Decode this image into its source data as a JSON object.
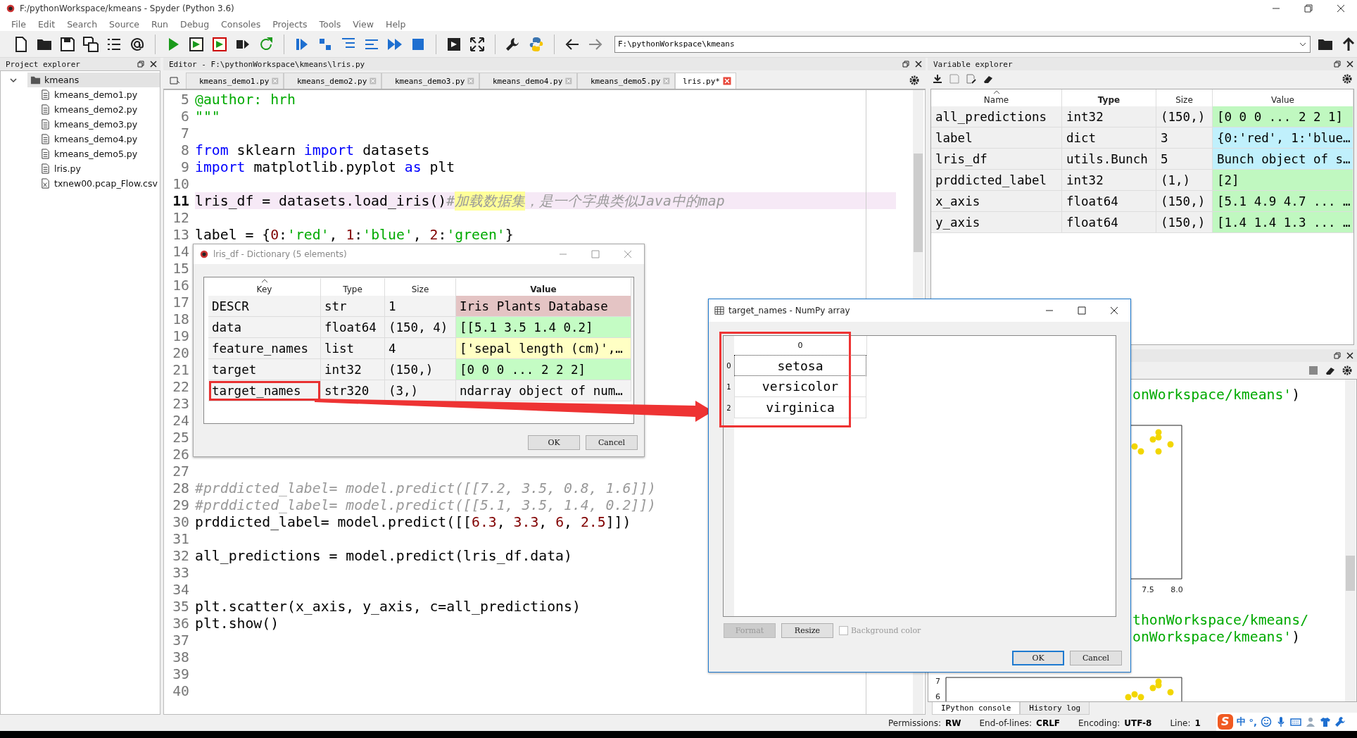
{
  "window": {
    "title": "F:/pythonWorkspace/kmeans - Spyder (Python 3.6)"
  },
  "menu": [
    "File",
    "Edit",
    "Search",
    "Source",
    "Run",
    "Debug",
    "Consoles",
    "Projects",
    "Tools",
    "View",
    "Help"
  ],
  "toolbar": {
    "path": "F:\\pythonWorkspace\\kmeans"
  },
  "project_explorer": {
    "title": "Project explorer",
    "tree": [
      {
        "label": "kmeans",
        "kind": "folder",
        "expanded": true,
        "selected": true,
        "children": [
          {
            "label": "kmeans_demo1.py",
            "kind": "file",
            "selected": false
          },
          {
            "label": "kmeans_demo2.py",
            "kind": "file",
            "selected": false
          },
          {
            "label": "kmeans_demo3.py",
            "kind": "file",
            "selected": false
          },
          {
            "label": "kmeans_demo4.py",
            "kind": "file",
            "selected": false
          },
          {
            "label": "kmeans_demo5.py",
            "kind": "file",
            "selected": false
          },
          {
            "label": "lris.py",
            "kind": "file",
            "selected": false
          },
          {
            "label": "txnew00.pcap_Flow.csv",
            "kind": "data",
            "selected": false
          }
        ]
      }
    ]
  },
  "editor": {
    "title": "Editor - F:\\pythonWorkspace\\kmeans\\lris.py",
    "tabs": [
      {
        "label": "kmeans_demo1.py",
        "selected": false
      },
      {
        "label": "kmeans_demo2.py",
        "selected": false
      },
      {
        "label": "kmeans_demo3.py",
        "selected": false
      },
      {
        "label": "kmeans_demo4.py",
        "selected": false
      },
      {
        "label": "kmeans_demo5.py",
        "selected": false
      },
      {
        "label": "lris.py*",
        "selected": true
      }
    ],
    "lines": [
      {
        "n": "5",
        "tokens": [
          {
            "t": "@author: hrh",
            "kind": "doc"
          }
        ]
      },
      {
        "n": "6",
        "tokens": [
          {
            "t": "\"\"\"",
            "kind": "doc"
          }
        ]
      },
      {
        "n": "7"
      },
      {
        "n": "8",
        "tokens": [
          {
            "t": "from",
            "kind": "keyword"
          },
          {
            "t": " sklearn ",
            "kind": "plain"
          },
          {
            "t": "import",
            "kind": "keyword"
          },
          {
            "t": " datasets",
            "kind": "plain"
          }
        ]
      },
      {
        "n": "9",
        "tokens": [
          {
            "t": "import",
            "kind": "keyword"
          },
          {
            "t": " matplotlib.pyplot ",
            "kind": "plain"
          },
          {
            "t": "as",
            "kind": "keyword"
          },
          {
            "t": " plt",
            "kind": "plain"
          }
        ]
      },
      {
        "n": "10"
      },
      {
        "n": "11",
        "current": true,
        "tokens": [
          {
            "t": "lris_df = datasets.load_iris()",
            "kind": "plain"
          },
          {
            "t": "#",
            "kind": "comment"
          },
          {
            "t": "加载数据集",
            "kind": "match"
          },
          {
            "t": "，是一个字典类似Java中的map",
            "kind": "comment"
          }
        ]
      },
      {
        "n": "12"
      },
      {
        "n": "13",
        "tokens": [
          {
            "t": "label = {",
            "kind": "plain"
          },
          {
            "t": "0",
            "kind": "number"
          },
          {
            "t": ":",
            "kind": "plain"
          },
          {
            "t": "'red'",
            "kind": "string"
          },
          {
            "t": ", ",
            "kind": "plain"
          },
          {
            "t": "1",
            "kind": "number"
          },
          {
            "t": ":",
            "kind": "plain"
          },
          {
            "t": "'blue'",
            "kind": "string"
          },
          {
            "t": ", ",
            "kind": "plain"
          },
          {
            "t": "2",
            "kind": "number"
          },
          {
            "t": ":",
            "kind": "plain"
          },
          {
            "t": "'green'",
            "kind": "string"
          },
          {
            "t": "}",
            "kind": "plain"
          }
        ]
      },
      {
        "n": "14"
      },
      {
        "n": "15"
      },
      {
        "n": "16"
      },
      {
        "n": "17"
      },
      {
        "n": "18"
      },
      {
        "n": "19"
      },
      {
        "n": "20"
      },
      {
        "n": "21"
      },
      {
        "n": "22"
      },
      {
        "n": "23"
      },
      {
        "n": "24"
      },
      {
        "n": "25"
      },
      {
        "n": "26"
      },
      {
        "n": "27"
      },
      {
        "n": "28",
        "tokens": [
          {
            "t": "#prddicted_label= model.predict([[7.2, 3.5, 0.8, 1.6]])",
            "kind": "comment"
          }
        ]
      },
      {
        "n": "29",
        "tokens": [
          {
            "t": "#prddicted_label= model.predict([[5.1, 3.5, 1.4, 0.2]])",
            "kind": "comment"
          }
        ]
      },
      {
        "n": "30",
        "tokens": [
          {
            "t": "prddicted_label= model.predict([[",
            "kind": "plain"
          },
          {
            "t": "6.3",
            "kind": "number"
          },
          {
            "t": ", ",
            "kind": "plain"
          },
          {
            "t": "3.3",
            "kind": "number"
          },
          {
            "t": ", ",
            "kind": "plain"
          },
          {
            "t": "6",
            "kind": "number"
          },
          {
            "t": ", ",
            "kind": "plain"
          },
          {
            "t": "2.5",
            "kind": "number"
          },
          {
            "t": "]])",
            "kind": "plain"
          }
        ]
      },
      {
        "n": "31"
      },
      {
        "n": "32",
        "tokens": [
          {
            "t": "all_predictions = model.predict(lris_df.data)",
            "kind": "plain"
          }
        ]
      },
      {
        "n": "33"
      },
      {
        "n": "34"
      },
      {
        "n": "35",
        "tokens": [
          {
            "t": "plt.scatter(x_axis, y_axis, c=all_predictions)",
            "kind": "plain"
          }
        ]
      },
      {
        "n": "36",
        "tokens": [
          {
            "t": "plt.show()",
            "kind": "plain"
          }
        ]
      },
      {
        "n": "37"
      },
      {
        "n": "38"
      },
      {
        "n": "39"
      },
      {
        "n": "40"
      }
    ]
  },
  "variable_explorer": {
    "title": "Variable explorer",
    "columns": [
      {
        "label": "Name",
        "sorted": true,
        "bold": false
      },
      {
        "label": "Type",
        "sorted": false,
        "bold": true
      },
      {
        "label": "Size",
        "sorted": false,
        "bold": false
      },
      {
        "label": "Value",
        "sorted": false,
        "bold": false
      }
    ],
    "rows": [
      {
        "name": "all_predictions",
        "type": "int32",
        "size": "(150,)",
        "value": "[0 0 0 ... 2 2 1]",
        "color": "#c0f8c0"
      },
      {
        "name": "label",
        "type": "dict",
        "size": "3",
        "value": "{0:'red', 1:'blue…",
        "color": "#c0f0fc"
      },
      {
        "name": "lris_df",
        "type": "utils.Bunch",
        "size": "5",
        "value": "Bunch object of s…",
        "color": "#c0f0fc"
      },
      {
        "name": "prddicted_label",
        "type": "int32",
        "size": "(1,)",
        "value": "[2]",
        "color": "#c0f8c0"
      },
      {
        "name": "x_axis",
        "type": "float64",
        "size": "(150,)",
        "value": "[5.1 4.9 4.7 ... …",
        "color": "#c0f8c0"
      },
      {
        "name": "y_axis",
        "type": "float64",
        "size": "(150,)",
        "value": "[1.4 1.4 1.3 ... …",
        "color": "#c0f8c0"
      }
    ]
  },
  "console": {
    "items": [
      {
        "kind": "text",
        "segments": [
          {
            "t": "onWorkspace/kmeans'",
            "kind": "string"
          },
          {
            "t": ")",
            "kind": "plain"
          }
        ]
      },
      {
        "kind": "xplot",
        "ticks": [
          "7.5",
          "8.0"
        ]
      },
      {
        "kind": "text",
        "segments": [
          {
            "t": "thonWorkspace/kmeans/",
            "kind": "string"
          }
        ]
      },
      {
        "kind": "text",
        "segments": [
          {
            "t": "onWorkspace/kmeans'",
            "kind": "string"
          },
          {
            "t": ")",
            "kind": "plain"
          }
        ]
      },
      {
        "kind": "yplot",
        "ticks": [
          "7",
          "6"
        ]
      }
    ],
    "tabs": [
      {
        "label": "IPython console",
        "selected": true
      },
      {
        "label": "History log",
        "selected": false
      }
    ]
  },
  "status_bar": [
    {
      "label": "Permissions:",
      "value": "RW"
    },
    {
      "label": "End-of-lines:",
      "value": "CRLF"
    },
    {
      "label": "Encoding:",
      "value": "UTF-8"
    },
    {
      "label": "Line:",
      "value": "1"
    }
  ],
  "ime": {
    "logo": "S",
    "items": [
      "中",
      "°,"
    ]
  },
  "dict_dialog": {
    "title": "lris_df - Dictionary (5 elements)",
    "columns": [
      {
        "label": "Key",
        "sorted": true,
        "bold": false
      },
      {
        "label": "Type",
        "sorted": false,
        "bold": false
      },
      {
        "label": "Size",
        "sorted": false,
        "bold": false
      },
      {
        "label": "Value",
        "sorted": false,
        "bold": true
      }
    ],
    "rows": [
      {
        "key": "DESCR",
        "type": "str",
        "size": "1",
        "value": "Iris Plants Database",
        "color": "#e4c4c4",
        "highlighted": false
      },
      {
        "key": "data",
        "type": "float64",
        "size": "(150, 4)",
        "value": "[[5.1 3.5 1.4 0.2]",
        "color": "#c4fcc4",
        "highlighted": false
      },
      {
        "key": "feature_names",
        "type": "list",
        "size": "4",
        "value": "['sepal length (cm)',…",
        "color": "#ffffc4",
        "highlighted": false
      },
      {
        "key": "target",
        "type": "int32",
        "size": "(150,)",
        "value": "[0 0 0 ... 2 2 2]",
        "color": "#c4fcc4",
        "highlighted": false
      },
      {
        "key": "target_names",
        "type": "str320",
        "size": "(3,)",
        "value": "ndarray object of num…",
        "highlighted": true
      }
    ],
    "buttons": [
      "OK",
      "Cancel"
    ]
  },
  "array_dialog": {
    "title": "target_names - NumPy array",
    "column": "0",
    "highlighted": true,
    "rows": [
      {
        "index": "0",
        "value": "setosa",
        "selected": true
      },
      {
        "index": "1",
        "value": "versicolor",
        "selected": false
      },
      {
        "index": "2",
        "value": "virginica",
        "selected": false
      }
    ],
    "tools": [
      {
        "label": "Format",
        "disabled": true
      },
      {
        "label": "Resize",
        "disabled": false
      }
    ],
    "background_color": {
      "label": "Background color",
      "checked": false,
      "disabled": true
    },
    "buttons": [
      {
        "label": "OK",
        "default": true
      },
      {
        "label": "Cancel",
        "default": false
      }
    ]
  }
}
